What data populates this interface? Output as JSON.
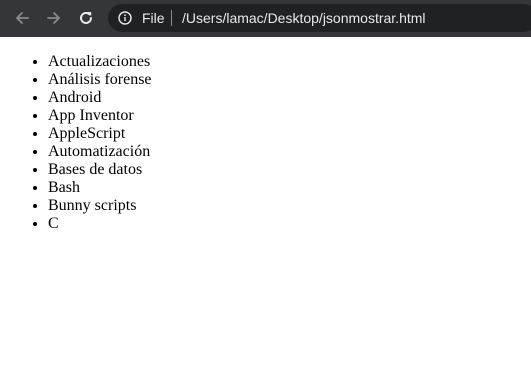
{
  "browser": {
    "scheme_label": "File",
    "url": "/Users/lamac/Desktop/jsonmostrar.html",
    "colors": {
      "toolbar": "#35363a",
      "omnibox": "#202124",
      "text": "#e8eaed"
    }
  },
  "page": {
    "items": [
      "Actualizaciones",
      "Análisis forense",
      "Android",
      "App Inventor",
      "AppleScript",
      "Automatización",
      "Bases de datos",
      "Bash",
      "Bunny scripts",
      "C"
    ]
  }
}
